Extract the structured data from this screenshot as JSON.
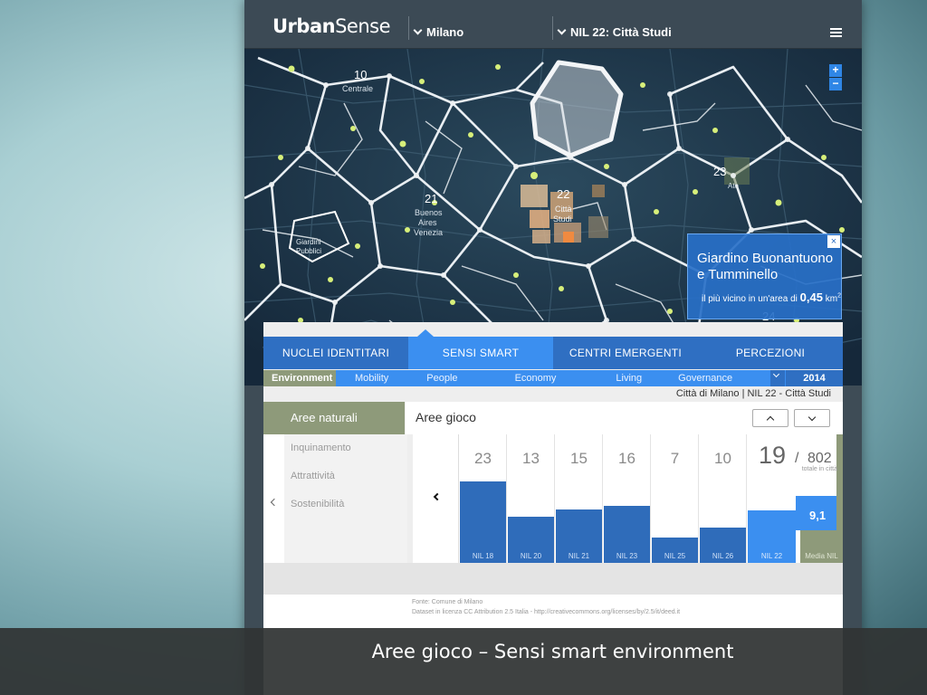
{
  "header": {
    "logo_bold": "Urban",
    "logo_light": "Sense",
    "city": "Milano",
    "nil": "NIL 22: Città Studi"
  },
  "map": {
    "labels": [
      "10",
      "Centrale",
      "21",
      "Buenos",
      "Aires",
      "Venezia",
      "22",
      "Città",
      "Studi",
      "23",
      "Giardini",
      "Pubblici",
      "24",
      "Parco",
      "Ate"
    ],
    "zoom_in": "+",
    "zoom_out": "−"
  },
  "popup": {
    "title_line1": "Giardino Buonantuono",
    "title_line2": "e Tumminello",
    "subtitle_prefix": "il più vicino in un'area di",
    "area_value": "0,45",
    "area_unit": "km",
    "area_exp": "2",
    "close": "×"
  },
  "tabs": [
    {
      "label": "NUCLEI IDENTITARI",
      "active": false
    },
    {
      "label": "SENSI SMART",
      "active": true
    },
    {
      "label": "CENTRI EMERGENTI",
      "active": false
    },
    {
      "label": "PERCEZIONI",
      "active": false
    }
  ],
  "subtabs": [
    {
      "label": "Environment",
      "active": true
    },
    {
      "label": "Mobility",
      "active": false
    },
    {
      "label": "People",
      "active": false
    },
    {
      "label": "Economy",
      "active": false
    },
    {
      "label": "Living",
      "active": false
    },
    {
      "label": "Governance",
      "active": false
    }
  ],
  "year": "2014",
  "breadcrumb": "Città di Milano | NIL 22 - Città Studi",
  "left": {
    "title": "Aree naturali",
    "items": [
      "Inquinamento",
      "Attrattività",
      "Sostenibilità"
    ]
  },
  "right_title": "Aree gioco",
  "chart_data": {
    "type": "bar",
    "categories": [
      "NIL 18",
      "NIL 20",
      "NIL 21",
      "NIL 23",
      "NIL 25",
      "NIL 26",
      "NIL 22"
    ],
    "values": [
      23,
      13,
      15,
      16,
      7,
      10,
      19
    ],
    "total": "802",
    "total_label": "totale in città",
    "average_label": "Media NIL",
    "average_value": "9,1",
    "active_category": "NIL 22"
  },
  "footer": {
    "line1": "Fonte: Comune di Milano",
    "line2": "Dataset in licenza CC Attribution 2.5 Italia - http://creativecommons.org/licenses/by/2.5/it/deed.it"
  },
  "caption": "Aree gioco – Sensi smart environment",
  "colors": {
    "accent": "#3b8ff0",
    "tab_bg": "#2f6fc2",
    "bar": "#2f6cba",
    "olive": "#8e9a7a",
    "header": "#3c4a55"
  }
}
